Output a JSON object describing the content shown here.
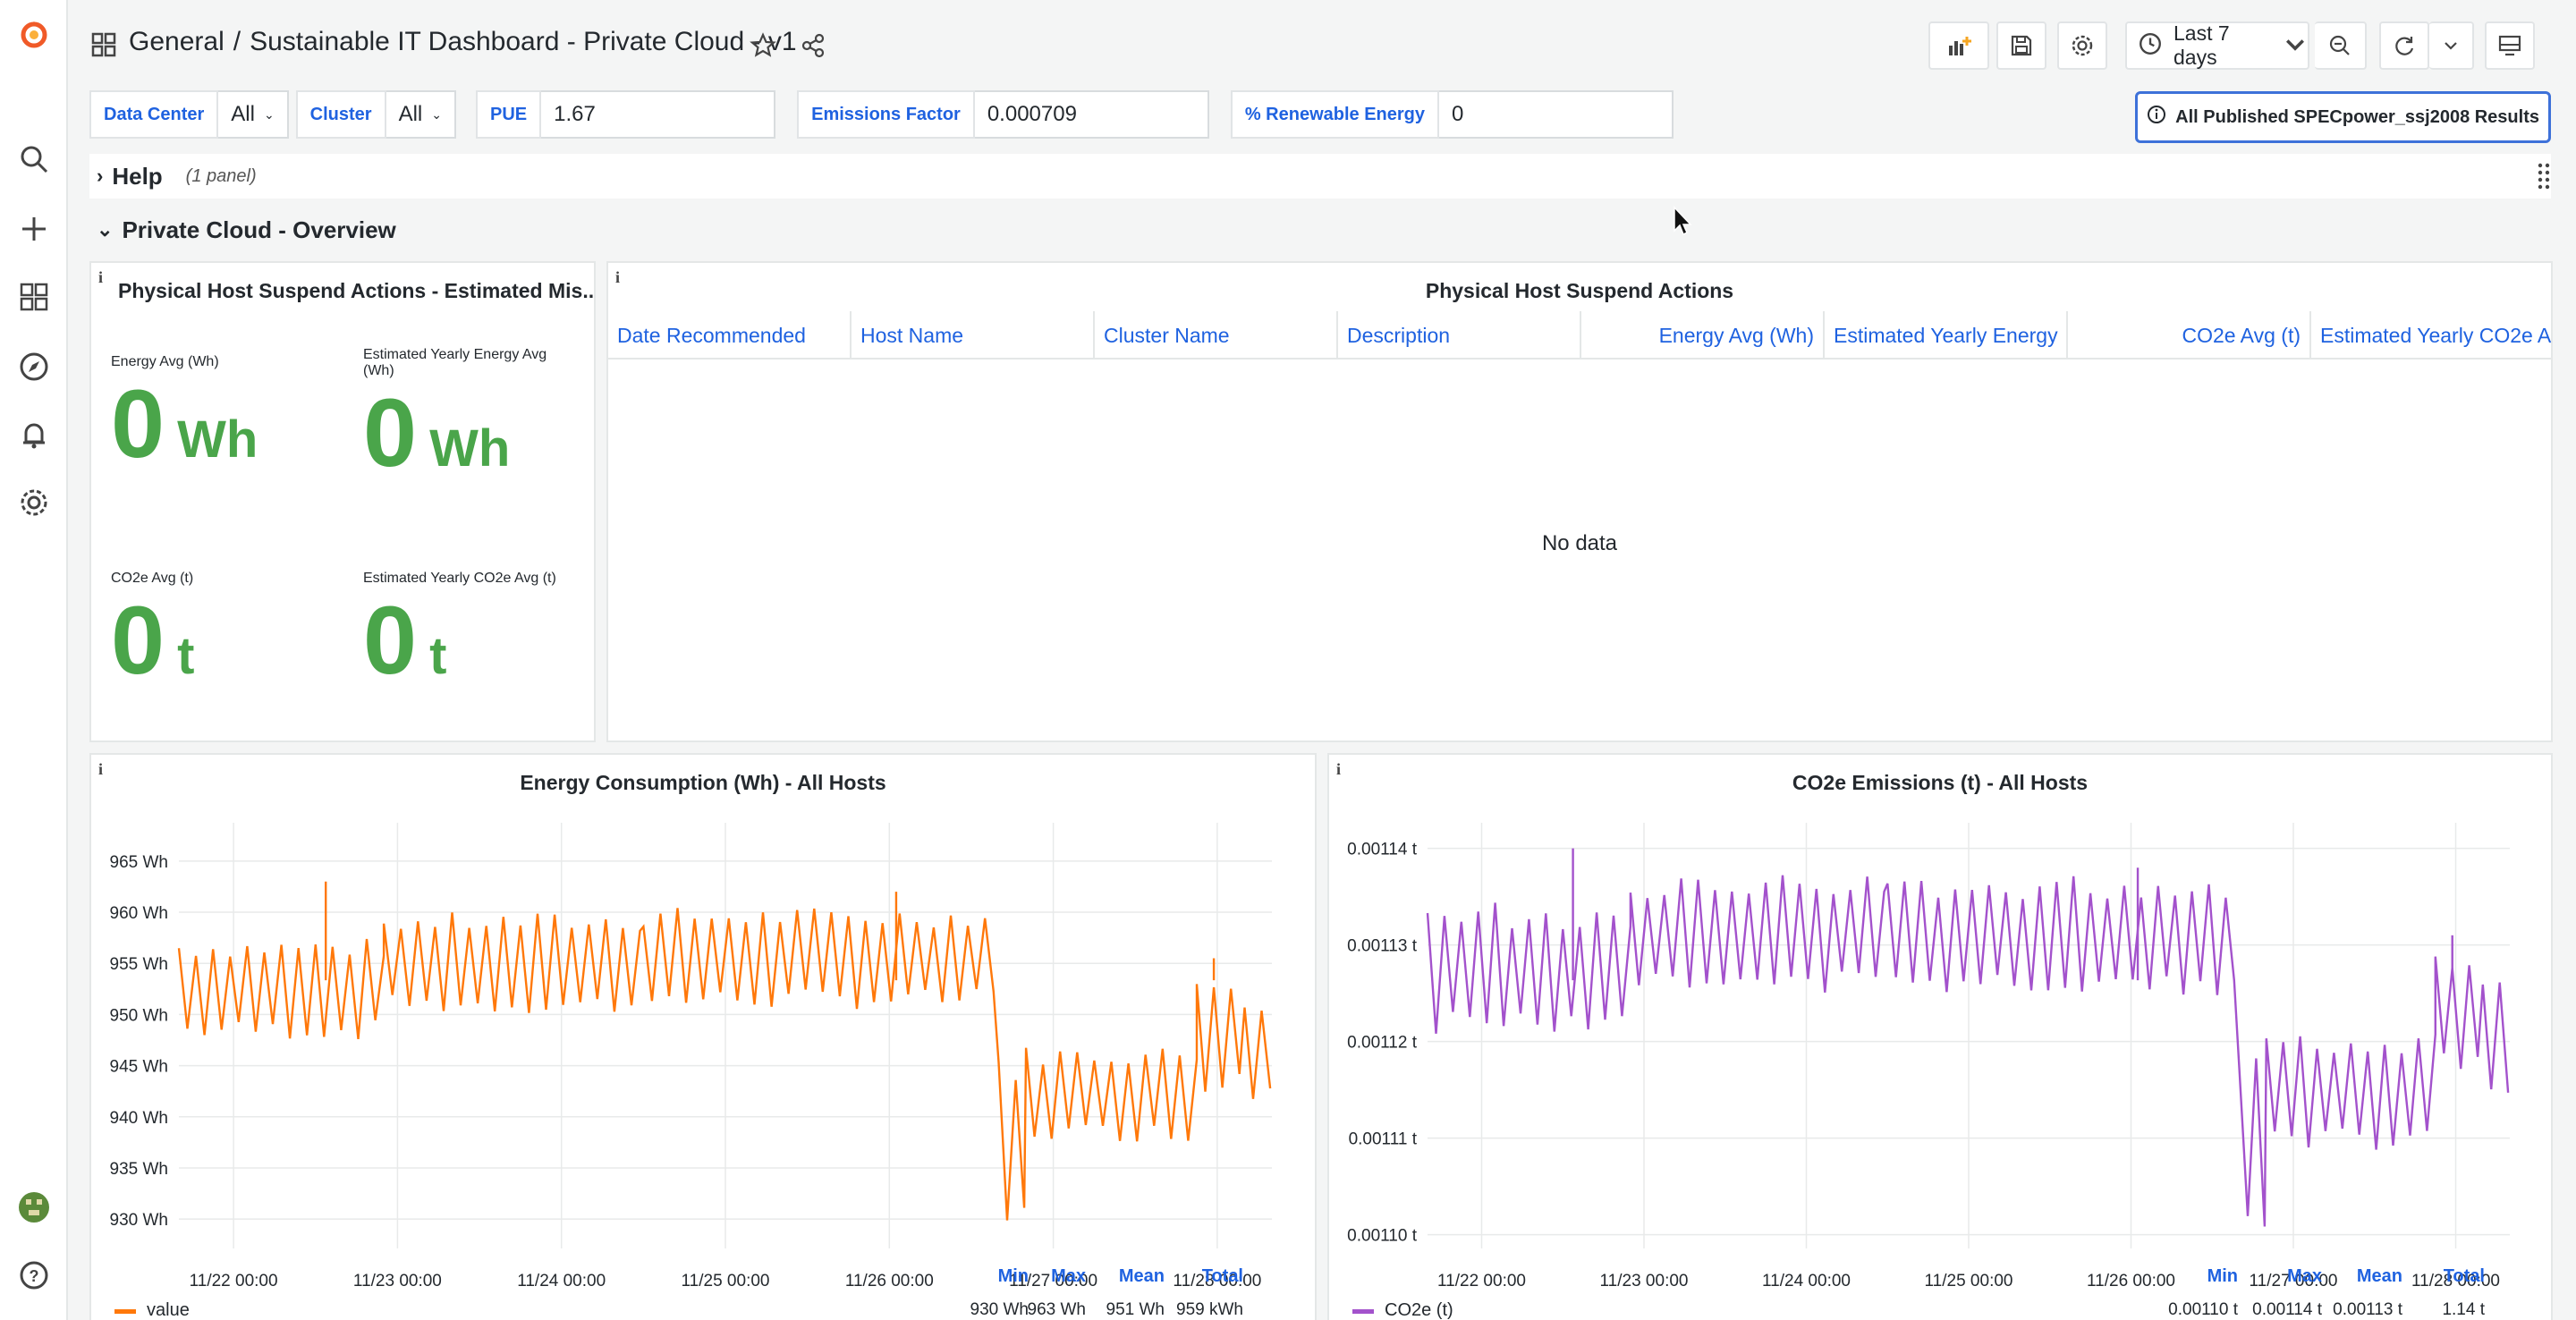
{
  "breadcrumb": {
    "folder": "General",
    "separator": "/",
    "title": "Sustainable IT Dashboard - Private Cloud - v1"
  },
  "toolbar": {
    "time_range": "Last 7 days"
  },
  "variables": [
    {
      "label": "Data Center",
      "value": "All",
      "kind": "select"
    },
    {
      "label": "Cluster",
      "value": "All",
      "kind": "select"
    },
    {
      "label": "PUE",
      "value": "1.67",
      "kind": "input"
    },
    {
      "label": "Emissions Factor",
      "value": "0.000709",
      "kind": "input"
    },
    {
      "label": "% Renewable Energy",
      "value": "0",
      "kind": "input"
    }
  ],
  "links": {
    "results_label": "All Published SPECpower_ssj2008 Results"
  },
  "rows": {
    "help": {
      "title": "Help",
      "subtitle": "(1 panel)"
    },
    "overview": {
      "title": "Private Cloud - Overview"
    }
  },
  "stats_panel": {
    "title": "Physical Host Suspend Actions - Estimated Mis...",
    "energy_avg": {
      "label": "Energy Avg (Wh)",
      "value": "0",
      "unit": "Wh"
    },
    "yearly_energy": {
      "label": "Estimated Yearly Energy Avg (Wh)",
      "value": "0",
      "unit": "Wh"
    },
    "co2_avg": {
      "label": "CO2e Avg (t)",
      "value": "0",
      "unit": "t"
    },
    "yearly_co2": {
      "label": "Estimated Yearly CO2e Avg (t)",
      "value": "0",
      "unit": "t"
    }
  },
  "table_panel": {
    "title": "Physical Host Suspend Actions",
    "columns": [
      "Date Recommended",
      "Host Name",
      "Cluster Name",
      "Description",
      "Energy Avg (Wh)",
      "Estimated Yearly Energy",
      "CO2e Avg (t)",
      "Estimated Yearly CO2e A"
    ],
    "empty_text": "No data"
  },
  "energy_panel": {
    "title": "Energy Consumption (Wh) - All Hosts",
    "legend": {
      "name": "value",
      "headers": [
        "Min",
        "Max",
        "Mean",
        "Total"
      ],
      "values": [
        "930 Wh",
        "963 Wh",
        "951 Wh",
        "959 kWh"
      ]
    }
  },
  "co2_panel": {
    "title": "CO2e Emissions (t) - All Hosts",
    "legend": {
      "name": "CO2e (t)",
      "headers": [
        "Min",
        "Max",
        "Mean",
        "Total"
      ],
      "values": [
        "0.00110 t",
        "0.00114 t",
        "0.00113 t",
        "1.14 t"
      ]
    }
  },
  "chart_data": [
    {
      "type": "line",
      "title": "Energy Consumption (Wh) - All Hosts",
      "color": "#ff780a",
      "x_ticks": [
        "11/22 00:00",
        "11/23 00:00",
        "11/24 00:00",
        "11/25 00:00",
        "11/26 00:00",
        "11/27 00:00",
        "11/28 00:00"
      ],
      "y_ticks": [
        "965 Wh",
        "960 Wh",
        "955 Wh",
        "950 Wh",
        "945 Wh",
        "940 Wh",
        "935 Wh",
        "930 Wh"
      ],
      "ylim": [
        928,
        967
      ],
      "series": [
        {
          "name": "value",
          "segments": [
            {
              "from": "11/21 16:00",
              "to": "11/22 22:00",
              "low": 948.5,
              "high": 956.5
            },
            {
              "from": "11/22 22:00",
              "to": "11/24 12:00",
              "low": 951,
              "high": 959
            },
            {
              "from": "11/24 12:00",
              "to": "11/26 16:00",
              "low": 951.5,
              "high": 959.5
            },
            {
              "from": "11/26 16:00",
              "to": "11/26 20:00",
              "low": 930,
              "high": 945
            },
            {
              "from": "11/26 20:00",
              "to": "11/27 21:00",
              "low": 938.5,
              "high": 946
            },
            {
              "from": "11/27 21:00",
              "to": "11/28 04:00",
              "low": 943.5,
              "high": 953
            },
            {
              "from": "11/28 04:00",
              "to": "11/28 08:00",
              "low": 942.5,
              "high": 951.5
            }
          ],
          "spikes": [
            {
              "x": "11/22 13:30",
              "y": 963
            },
            {
              "x": "11/26 01:00",
              "y": 962
            },
            {
              "x": "11/27 23:30",
              "y": 955.5
            }
          ]
        }
      ]
    },
    {
      "type": "line",
      "title": "CO2e Emissions (t) - All Hosts",
      "color": "#a352cc",
      "x_ticks": [
        "11/22 00:00",
        "11/23 00:00",
        "11/24 00:00",
        "11/25 00:00",
        "11/26 00:00",
        "11/27 00:00",
        "11/28 00:00"
      ],
      "y_ticks": [
        "0.00114 t",
        "0.00113 t",
        "0.00112 t",
        "0.00111 t",
        "0.00110 t"
      ],
      "ylim": [
        0.0010995,
        0.0011408
      ],
      "series": [
        {
          "name": "CO2e (t)",
          "segments": [
            {
              "from": "11/21 16:00",
              "to": "11/22 22:00",
              "low": 0.001122,
              "high": 0.001133
            },
            {
              "from": "11/22 22:00",
              "to": "11/24 12:00",
              "low": 0.001126,
              "high": 0.001136
            },
            {
              "from": "11/24 12:00",
              "to": "11/26 16:00",
              "low": 0.001126,
              "high": 0.001136
            },
            {
              "from": "11/26 16:00",
              "to": "11/26 20:00",
              "low": 0.0011,
              "high": 0.001118
            },
            {
              "from": "11/26 20:00",
              "to": "11/27 21:00",
              "low": 0.00111,
              "high": 0.00112
            },
            {
              "from": "11/27 21:00",
              "to": "11/28 04:00",
              "low": 0.001118,
              "high": 0.001128
            },
            {
              "from": "11/28 04:00",
              "to": "11/28 08:00",
              "low": 0.001116,
              "high": 0.001127
            }
          ],
          "spikes": [
            {
              "x": "11/22 13:30",
              "y": 0.00114
            },
            {
              "x": "11/26 01:00",
              "y": 0.001138
            },
            {
              "x": "11/27 23:30",
              "y": 0.001131
            }
          ]
        }
      ]
    }
  ]
}
